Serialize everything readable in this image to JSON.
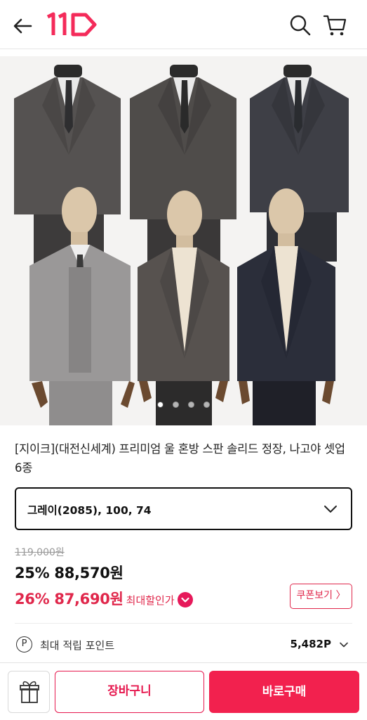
{
  "header": {
    "back_icon": "arrow-left-icon",
    "logo_text": "11",
    "logo_color": "#f42b5a",
    "search_icon": "search-icon",
    "cart_icon": "cart-icon"
  },
  "gallery": {
    "image_subject": "men's suits on mannequins",
    "page_indicator": {
      "current": 1,
      "total": 4
    }
  },
  "product": {
    "title": "[지이크](대전신세계) 프리미엄 울 혼방 스판 솔리드 정장, 나고야 셋업 6종"
  },
  "option": {
    "selected": "그레이(2085), 100, 74",
    "icon": "chevron-down-icon"
  },
  "price": {
    "original": "119,000원",
    "sale_line": "25% 88,570원",
    "max_line": "26% 87,690원",
    "max_label": "최대할인가",
    "accent_color": "#e0274b"
  },
  "coupon": {
    "label": "쿠폰보기 〉"
  },
  "points": {
    "label": "최대 적립 포인트",
    "value": "5,482P",
    "icon_letter": "P"
  },
  "bottom": {
    "gift_icon": "gift-icon",
    "cart_label": "장바구니",
    "buy_label": "바로구매",
    "buy_color": "#f2214e"
  }
}
